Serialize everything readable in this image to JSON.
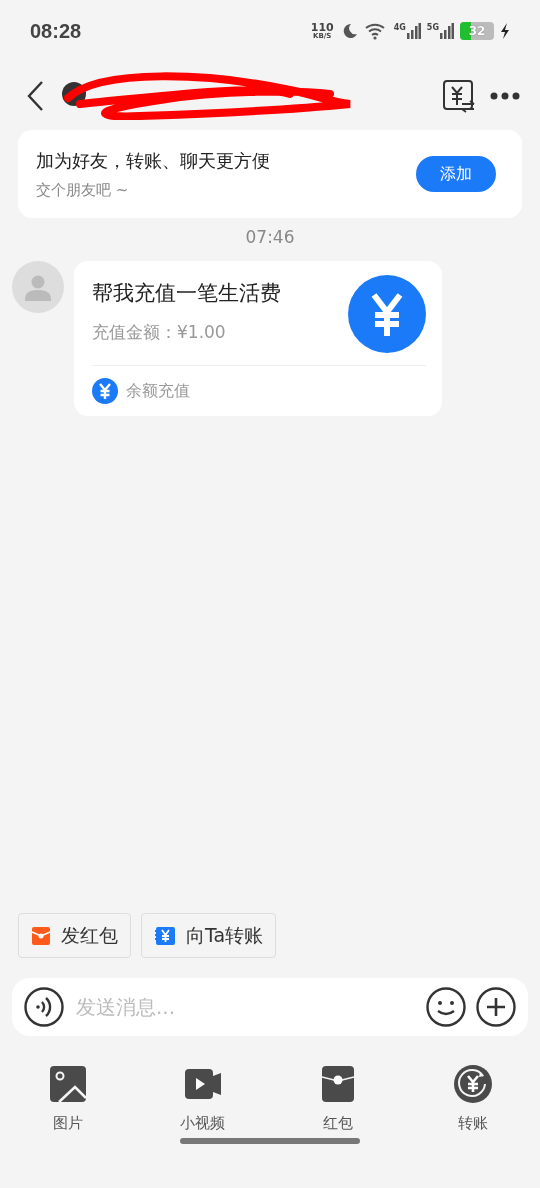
{
  "status_bar": {
    "time": "08:28",
    "net_speed": "110",
    "net_unit": "KB/S",
    "sig1": "4G",
    "sig2": "5G",
    "battery": "32",
    "charging": true
  },
  "friend_prompt": {
    "title": "加为好友，转账、聊天更方便",
    "subtitle": "交个朋友吧 ~",
    "button": "添加"
  },
  "timestamp": "07:46",
  "message": {
    "title": "帮我充值一笔生活费",
    "amount": "充值金额：¥1.00",
    "footer": "余额充值"
  },
  "quick_actions": [
    {
      "label": "发红包",
      "kind": "redpacket"
    },
    {
      "label": "向Ta转账",
      "kind": "transfer"
    }
  ],
  "input": {
    "placeholder": "发送消息..."
  },
  "toolbar": [
    {
      "label": "图片",
      "kind": "image"
    },
    {
      "label": "小视频",
      "kind": "video"
    },
    {
      "label": "红包",
      "kind": "redpacket"
    },
    {
      "label": "转账",
      "kind": "transfer"
    }
  ]
}
